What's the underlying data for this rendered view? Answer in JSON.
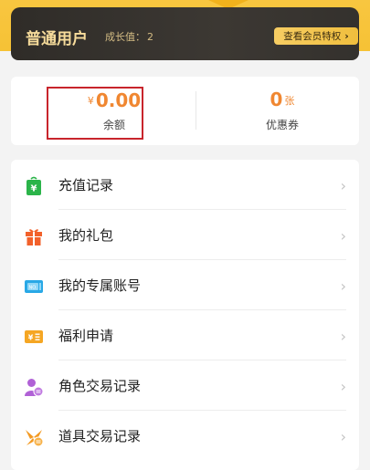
{
  "member": {
    "level_name": "普通用户",
    "growth_label": "成长值：",
    "growth_value": "2",
    "privilege_button": "查看会员特权",
    "privilege_chevron": "›"
  },
  "stats": {
    "balance": {
      "currency": "¥",
      "value": "0.00",
      "label": "余额"
    },
    "coupon": {
      "value": "0",
      "unit": "张",
      "label": "优惠券"
    }
  },
  "menu": {
    "chevron": "›",
    "items": [
      {
        "label": "充值记录",
        "icon": "recharge-bag-icon",
        "color": "#2bb44a"
      },
      {
        "label": "我的礼包",
        "icon": "gift-icon",
        "color": "#f2612b"
      },
      {
        "label": "我的专属账号",
        "icon": "account-card-icon",
        "color": "#29a8e6"
      },
      {
        "label": "福利申请",
        "icon": "welfare-ticket-icon",
        "color": "#f5a623"
      },
      {
        "label": "角色交易记录",
        "icon": "role-trade-icon",
        "color": "#b061d6"
      },
      {
        "label": "道具交易记录",
        "icon": "item-trade-icon",
        "color": "#f39a23"
      }
    ]
  },
  "colors": {
    "header_yellow": "#f6c235",
    "card_dark": "#34312d",
    "accent_orange": "#f08731",
    "highlight_red": "#c8252c"
  }
}
